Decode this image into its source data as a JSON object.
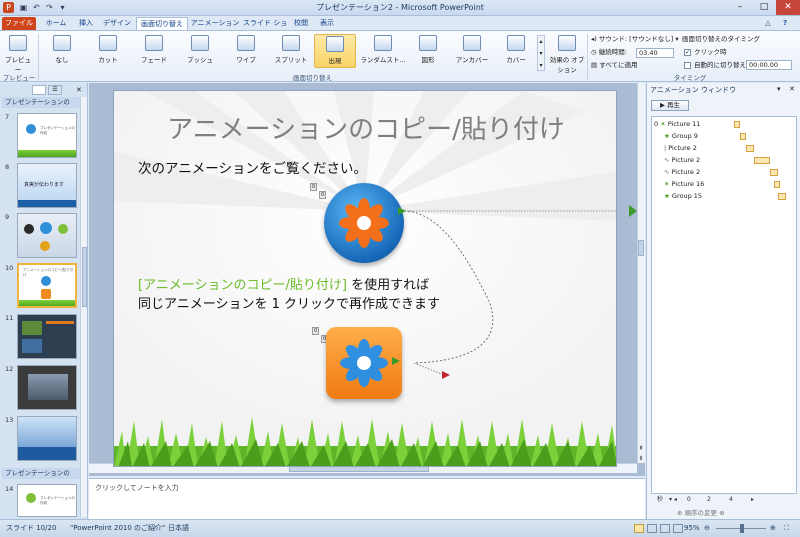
{
  "window": {
    "title": "プレゼンテーション2 - Microsoft PowerPoint"
  },
  "tabs": [
    "ファイル",
    "ホーム",
    "挿入",
    "デザイン",
    "画面切り替え",
    "アニメーション",
    "スライド ショー",
    "校閲",
    "表示"
  ],
  "ribbon": {
    "preview_label": "プレビュー",
    "preview_group": "プレビュー",
    "transitions": [
      "なし",
      "カット",
      "フェード",
      "プッシュ",
      "ワイプ",
      "スプリット",
      "出現",
      "ランダムスト...",
      "図形",
      "アンカバー",
      "カバー"
    ],
    "transitions_group": "画面切り替え",
    "effect_options": "効果の オプション",
    "sound_label": "サウンド:",
    "sound_value": "[サウンドなし]",
    "duration_label": "継続時間:",
    "duration_value": "03.40",
    "apply_all": "すべてに適用",
    "advance_label": "画面切り替えのタイミング",
    "on_click": "クリック時",
    "after_label": "自動的に切り替え",
    "after_value": "00:00.00",
    "timing_group": "タイミング"
  },
  "left_panel": {
    "section1": "プレゼンテーションの",
    "section2": "プレゼンテーションの",
    "slides": [
      "7",
      "8",
      "9",
      "10",
      "11",
      "12",
      "13",
      "14"
    ],
    "thumb8_text": "真実が伝わります",
    "thumb7_text": "プレゼンテーションの作成",
    "thumb10_text": "アニメーションのコピー/貼り付け",
    "thumb14_text": "プレゼンテーションの作成"
  },
  "slide": {
    "title": "アニメーションのコピー/貼り付け",
    "line1": "次のアニメーションをご覧ください。",
    "highlight": "[アニメーションのコピー/貼り付け]",
    "line2a": " を使用すれば",
    "line3": "同じアニメーションを 1 クリックで再作成できます",
    "tag1": "0",
    "tag2": "0",
    "tag3": "0",
    "tag4": "0",
    "tag5": "0"
  },
  "notes": {
    "placeholder": "クリックしてノートを入力"
  },
  "anim_pane": {
    "title": "アニメーション ウィンドウ",
    "play": "再生",
    "items": [
      {
        "num": "0",
        "name": "Picture 11"
      },
      {
        "num": "",
        "name": "Group 9"
      },
      {
        "num": "",
        "name": "Picture 2"
      },
      {
        "num": "",
        "name": "Picture 2"
      },
      {
        "num": "",
        "name": "Picture 2"
      },
      {
        "num": "",
        "name": "Picture 16"
      },
      {
        "num": "",
        "name": "Group 15"
      }
    ],
    "seconds_label": "秒",
    "timeline": [
      "0",
      "2",
      "4"
    ],
    "reorder": "順序の変更"
  },
  "status": {
    "slide": "スライド 10/20",
    "theme": "\"PowerPoint 2010 のご紹介\"",
    "language": "日本語",
    "zoom": "95%"
  }
}
